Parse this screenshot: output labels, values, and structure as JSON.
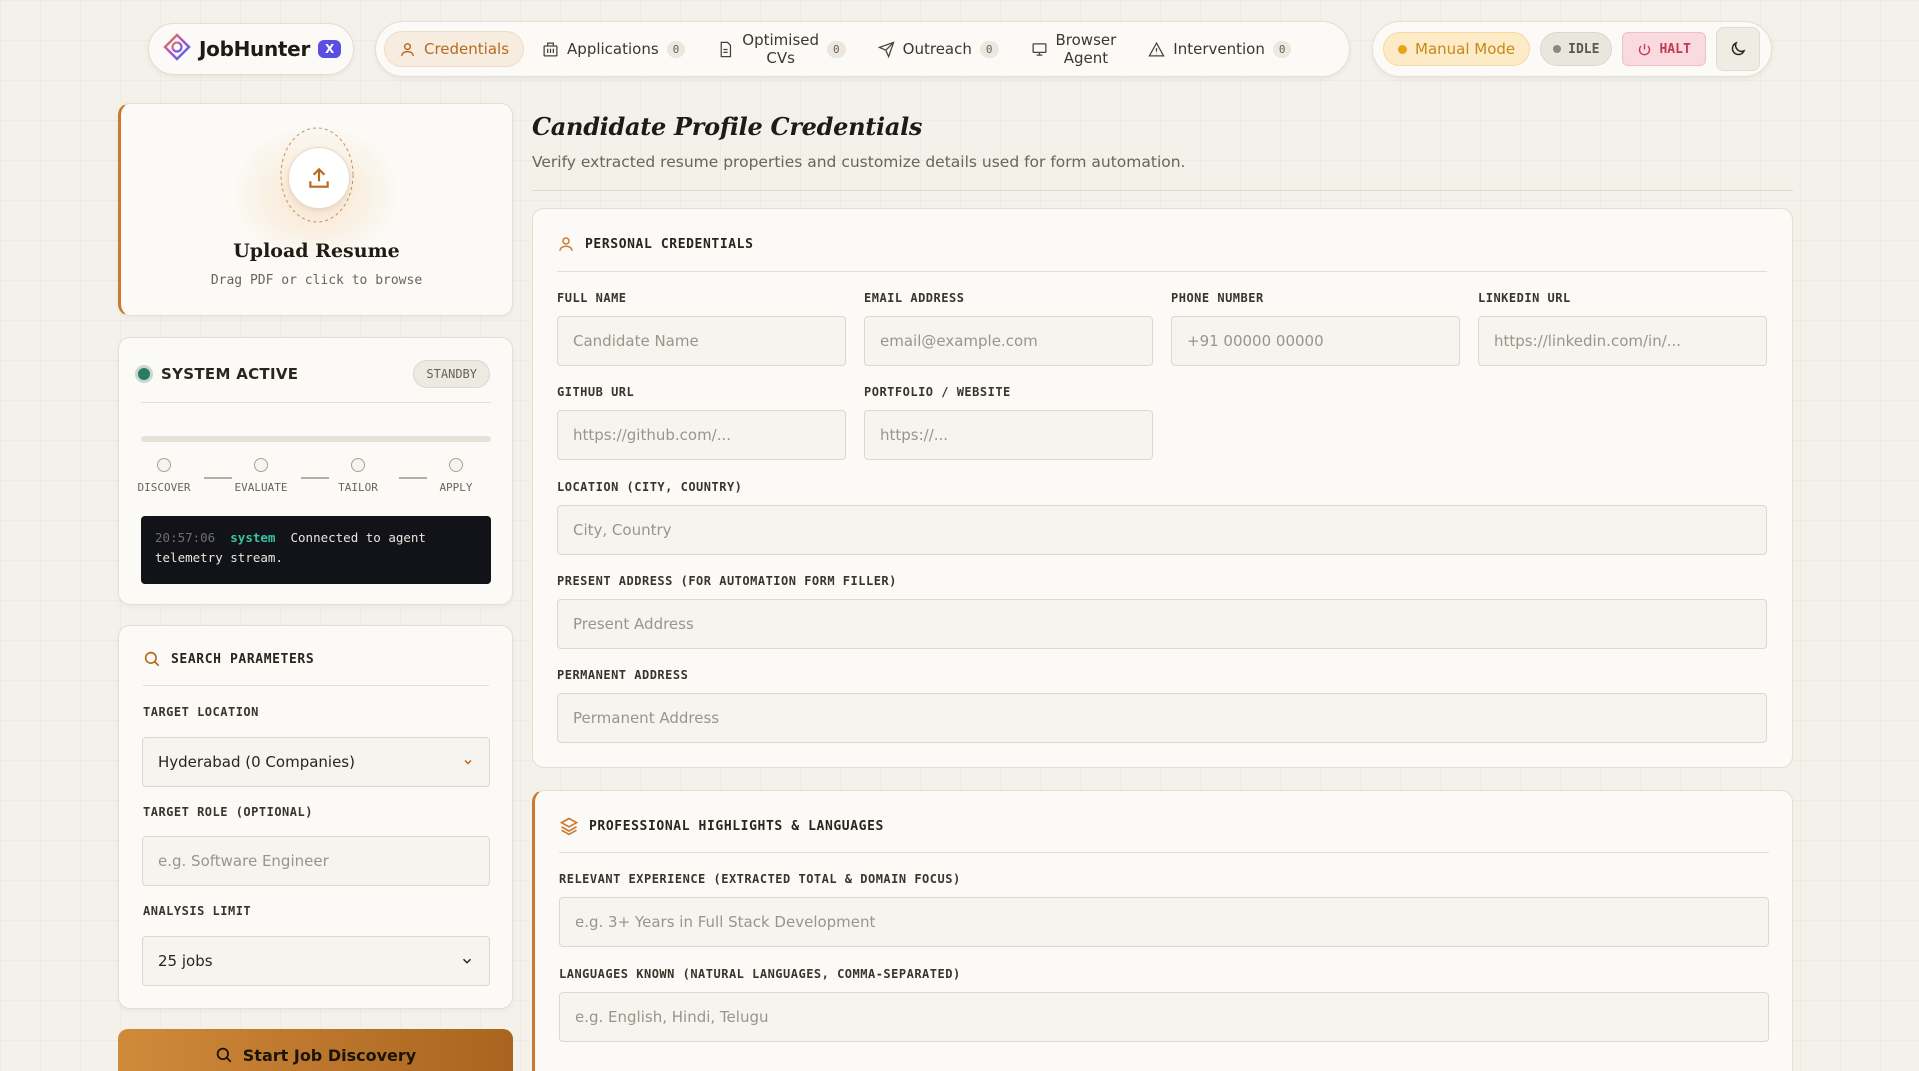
{
  "brand": {
    "name": "JobHunter",
    "badge": "X"
  },
  "nav": {
    "credentials": "Credentials",
    "applications": "Applications",
    "applications_count": "0",
    "optimised_line1": "Optimised",
    "optimised_line2": "CVs",
    "optimised_count": "0",
    "outreach": "Outreach",
    "outreach_count": "0",
    "browser_line1": "Browser",
    "browser_line2": "Agent",
    "intervention": "Intervention",
    "intervention_count": "0"
  },
  "controls": {
    "manual_mode": "Manual Mode",
    "idle": "IDLE",
    "halt": "HALT"
  },
  "colors": {
    "accent": "#c97a2e",
    "manual": "#c48a17",
    "halt": "#c13a4e",
    "active": "#2e7a63",
    "brand_badge": "#5a4fe0"
  },
  "upload": {
    "title": "Upload Resume",
    "subtitle": "Drag PDF or click to browse"
  },
  "status": {
    "title": "SYSTEM ACTIVE",
    "badge": "STANDBY",
    "progress": 0,
    "steps": [
      "DISCOVER",
      "EVALUATE",
      "TAILOR",
      "APPLY"
    ],
    "log": {
      "time": "20:57:06",
      "source": "system",
      "message": "Connected to agent telemetry stream."
    }
  },
  "search": {
    "title": "SEARCH PARAMETERS",
    "location_label": "TARGET LOCATION",
    "location_value": "Hyderabad (0 Companies)",
    "role_label": "TARGET ROLE (OPTIONAL)",
    "role_placeholder": "e.g. Software Engineer",
    "limit_label": "ANALYSIS LIMIT",
    "limit_value": "25 jobs",
    "start_button": "Start Job Discovery"
  },
  "main": {
    "title": "Candidate Profile Credentials",
    "subtitle": "Verify extracted resume properties and customize details used for form automation."
  },
  "personal": {
    "title": "PERSONAL CREDENTIALS",
    "full_name_label": "FULL NAME",
    "full_name_ph": "Candidate Name",
    "email_label": "EMAIL ADDRESS",
    "email_ph": "email@example.com",
    "phone_label": "PHONE NUMBER",
    "phone_ph": "+91 00000 00000",
    "linkedin_label": "LINKEDIN URL",
    "linkedin_ph": "https://linkedin.com/in/...",
    "github_label": "GITHUB URL",
    "github_ph": "https://github.com/...",
    "portfolio_label": "PORTFOLIO / WEBSITE",
    "portfolio_ph": "https://...",
    "location_label": "LOCATION (CITY, COUNTRY)",
    "location_ph": "City, Country",
    "present_label": "PRESENT ADDRESS (FOR AUTOMATION FORM FILLER)",
    "present_ph": "Present Address",
    "permanent_label": "PERMANENT ADDRESS",
    "permanent_ph": "Permanent Address"
  },
  "professional": {
    "title": "PROFESSIONAL HIGHLIGHTS & LANGUAGES",
    "experience_label": "RELEVANT EXPERIENCE (EXTRACTED TOTAL & DOMAIN FOCUS)",
    "experience_ph": "e.g. 3+ Years in Full Stack Development",
    "languages_label": "LANGUAGES KNOWN (NATURAL LANGUAGES, COMMA-SEPARATED)",
    "languages_ph": "e.g. English, Hindi, Telugu"
  }
}
